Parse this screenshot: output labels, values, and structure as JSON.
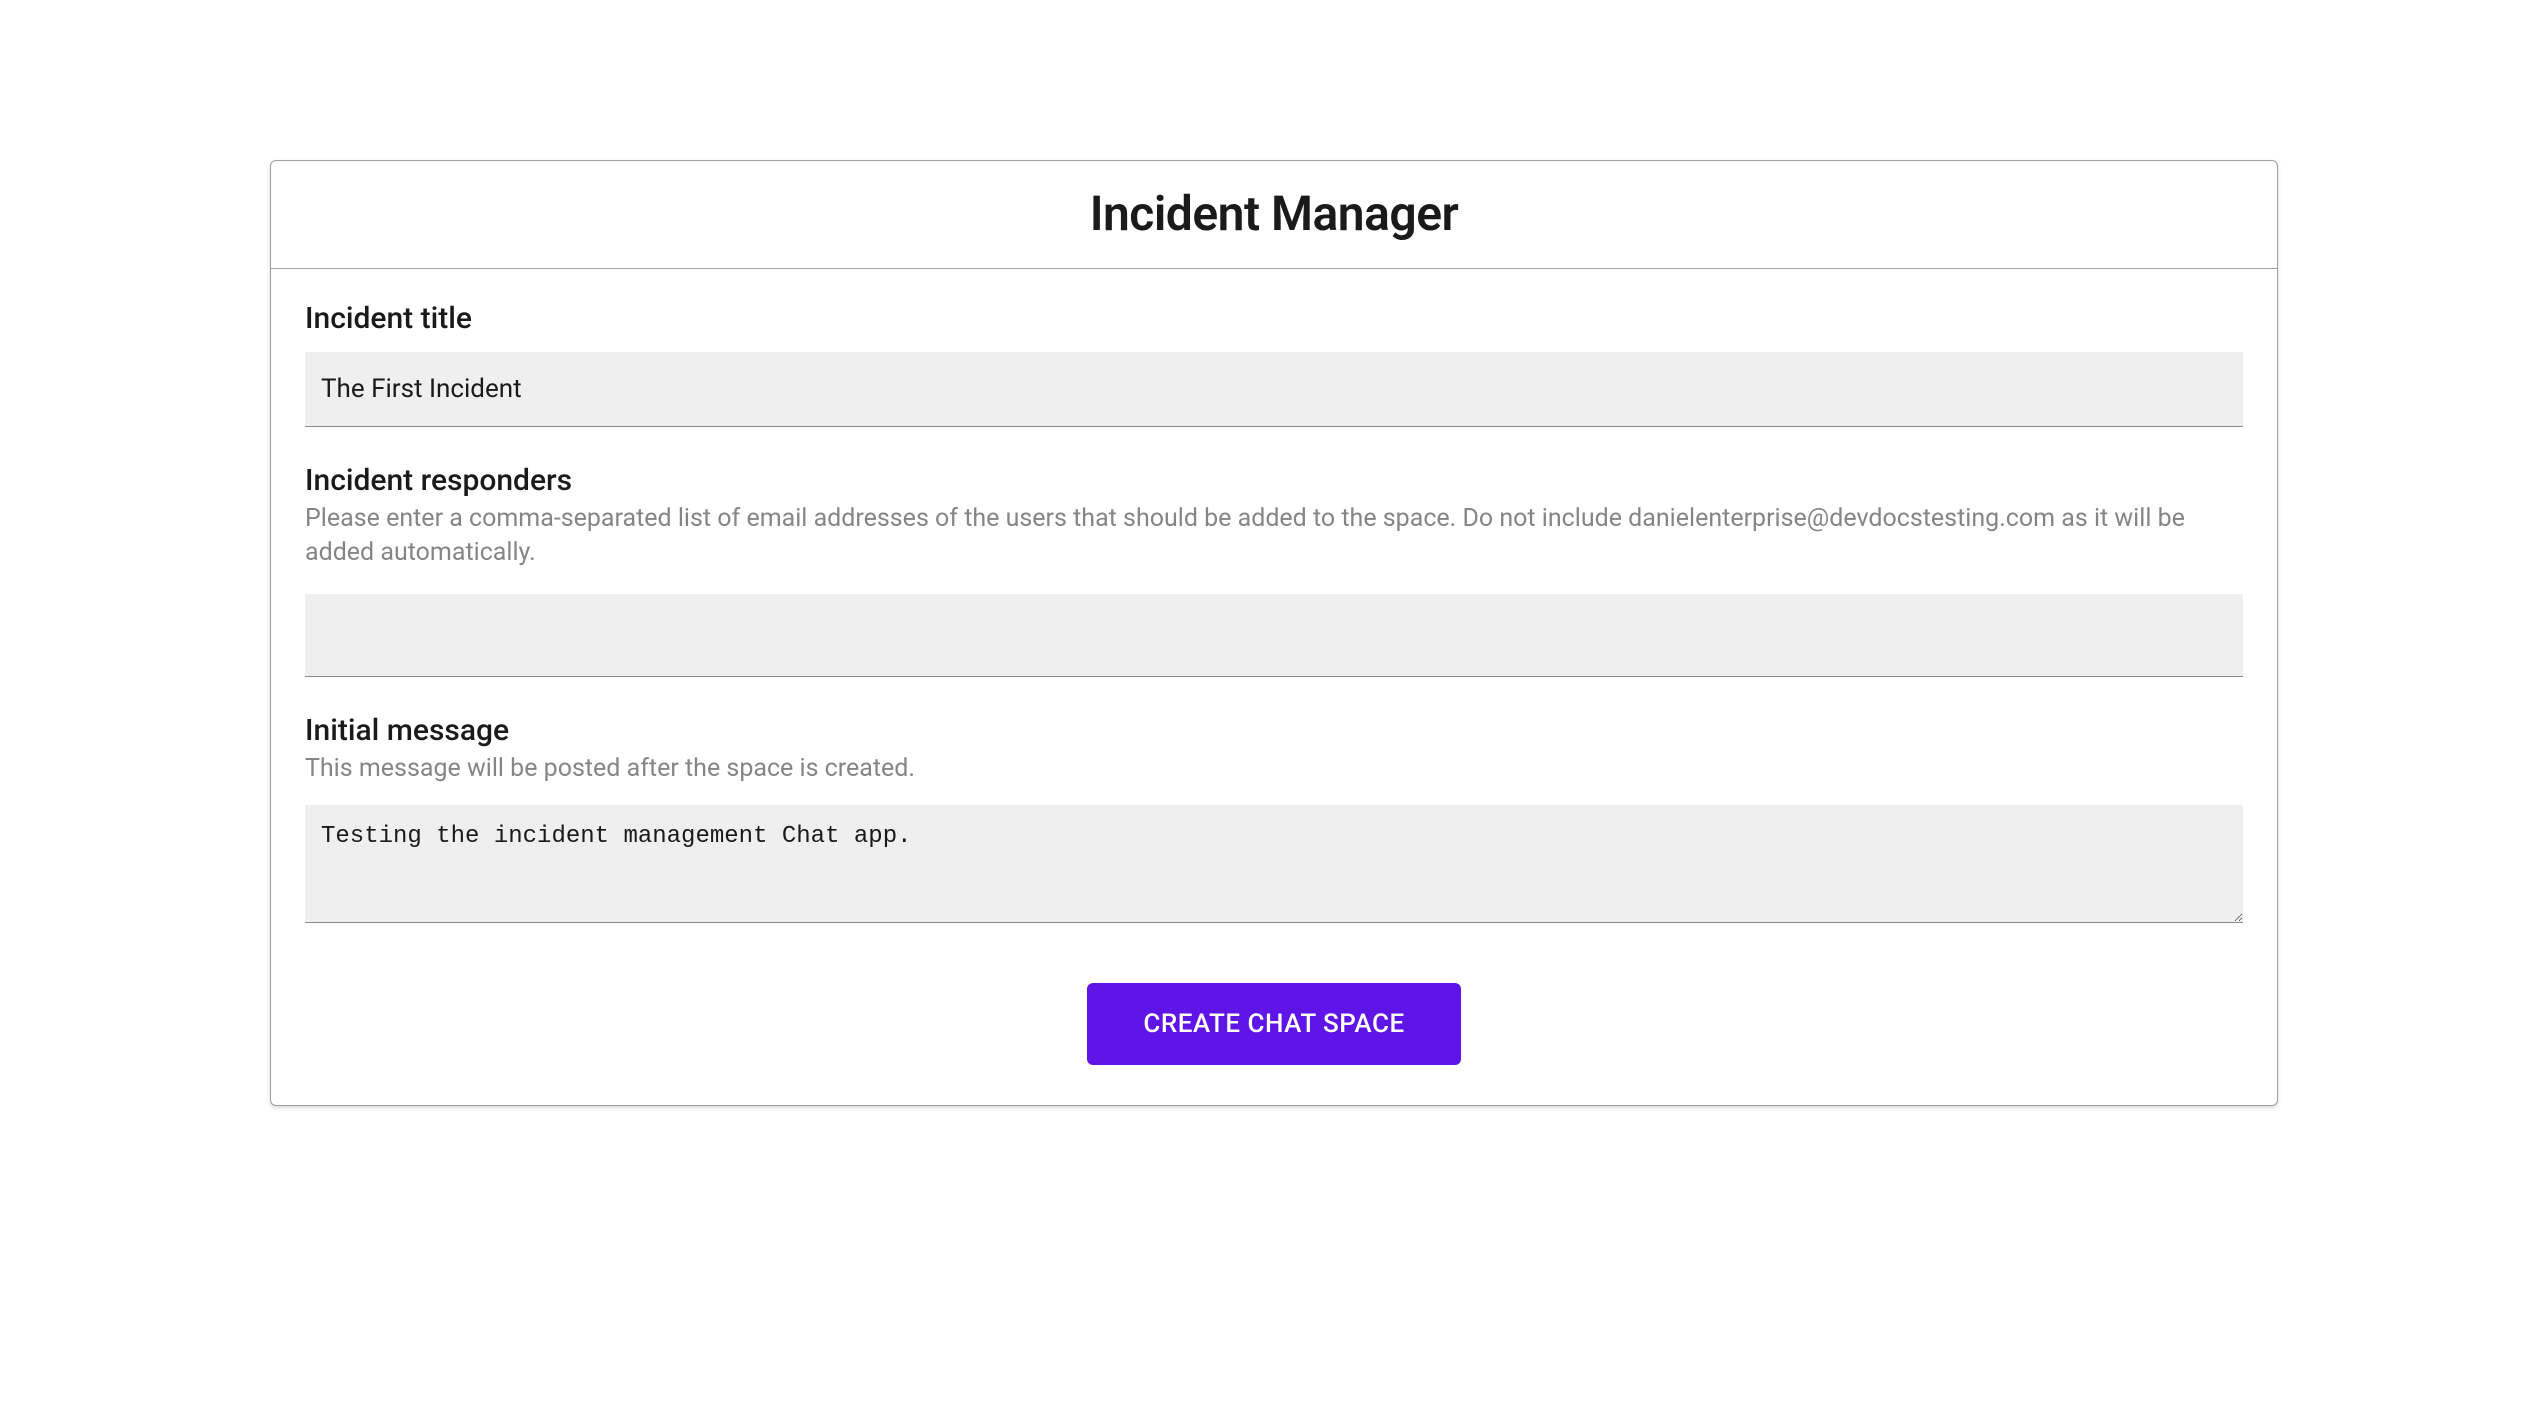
{
  "header": {
    "title": "Incident Manager"
  },
  "form": {
    "incident_title": {
      "label": "Incident title",
      "value": "The First Incident"
    },
    "responders": {
      "label": "Incident responders",
      "hint": "Please enter a comma-separated list of email addresses of the users that should be added to the space. Do not include danielenterprise@devdocstesting.com as it will be added automatically.",
      "value": ""
    },
    "initial_message": {
      "label": "Initial message",
      "hint": "This message will be posted after the space is created.",
      "value": "Testing the incident management Chat app."
    },
    "submit_label": "CREATE CHAT SPACE"
  }
}
